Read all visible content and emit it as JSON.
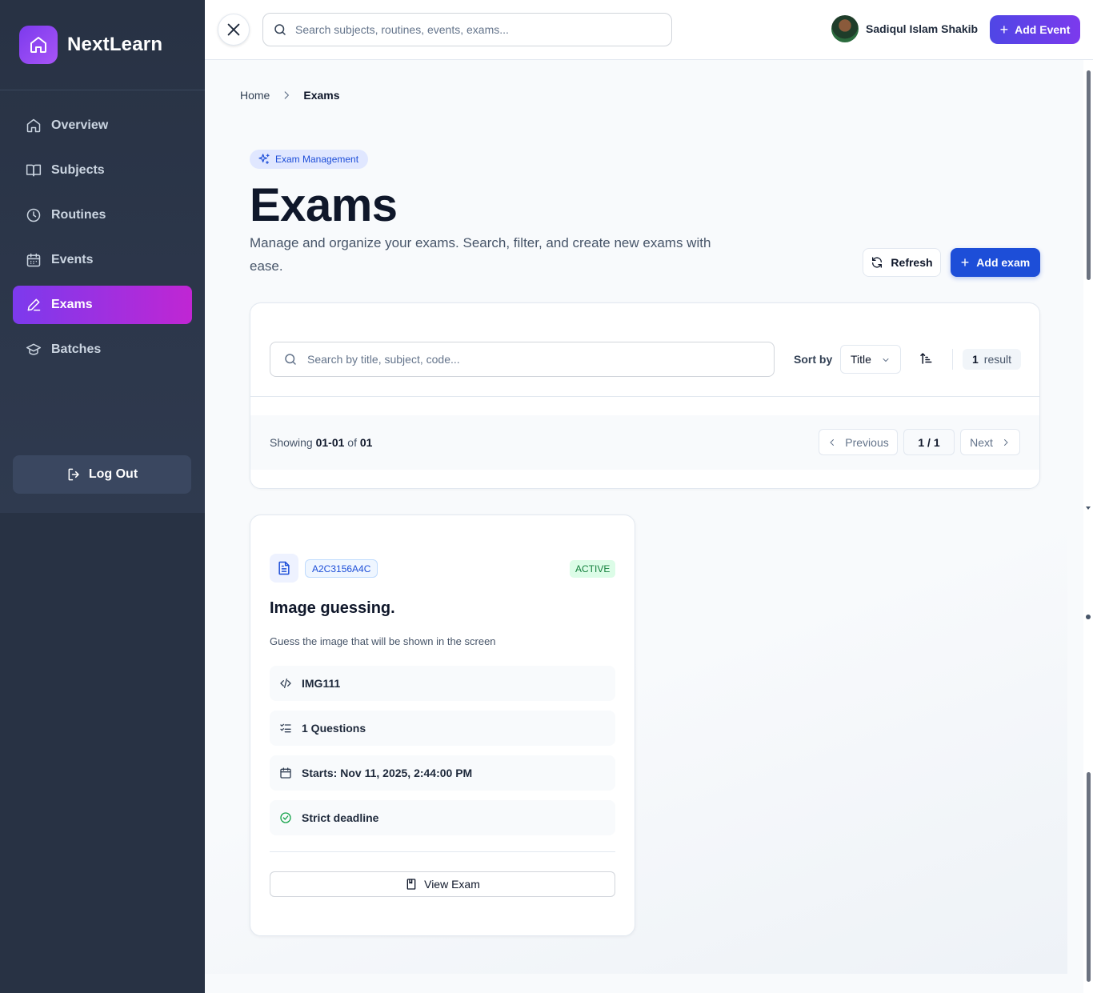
{
  "brand": {
    "name": "NextLearn",
    "logo_icon": "home-icon",
    "accent": "#7c3aed"
  },
  "sidebar": {
    "items": [
      {
        "label": "Overview",
        "icon": "home-icon",
        "active": false
      },
      {
        "label": "Subjects",
        "icon": "book-icon",
        "active": false
      },
      {
        "label": "Routines",
        "icon": "clock-icon",
        "active": false
      },
      {
        "label": "Events",
        "icon": "calendar-icon",
        "active": false
      },
      {
        "label": "Exams",
        "icon": "pencil-icon",
        "active": true
      },
      {
        "label": "Batches",
        "icon": "graduation-cap-icon",
        "active": false
      }
    ],
    "logout_label": "Log Out"
  },
  "topbar": {
    "search_placeholder": "Search subjects, routines, events, exams...",
    "user_name": "Sadiqul Islam Shakib",
    "add_event_label": "Add Event"
  },
  "breadcrumb": {
    "home": "Home",
    "current": "Exams"
  },
  "header": {
    "pill": "Exam Management",
    "title": "Exams",
    "subtitle": "Manage and organize your exams. Search, filter, and create new exams with ease.",
    "refresh_label": "Refresh",
    "add_exam_label": "Add exam"
  },
  "filters": {
    "search_placeholder": "Search by title, subject, code...",
    "sort_label": "Sort by",
    "sort_value": "Title",
    "result_count": "1",
    "result_label": "result"
  },
  "pagination": {
    "showing_prefix": "Showing",
    "range": "01-01",
    "of": "of",
    "total": "01",
    "prev_label": "Previous",
    "page": "1 / 1",
    "next_label": "Next"
  },
  "exam": {
    "code": "A2C3156A4C",
    "status": "ACTIVE",
    "title": "Image guessing.",
    "description": "Guess the image that will be shown in the screen",
    "subject_code": "IMG111",
    "questions": "1 Questions",
    "starts": "Starts: Nov 11, 2025, 2:44:00 PM",
    "deadline": "Strict deadline",
    "view_label": "View Exam"
  },
  "colors": {
    "primary": "#1d4ed8",
    "success": "#15803d",
    "sidebar_bg": "#283244"
  }
}
